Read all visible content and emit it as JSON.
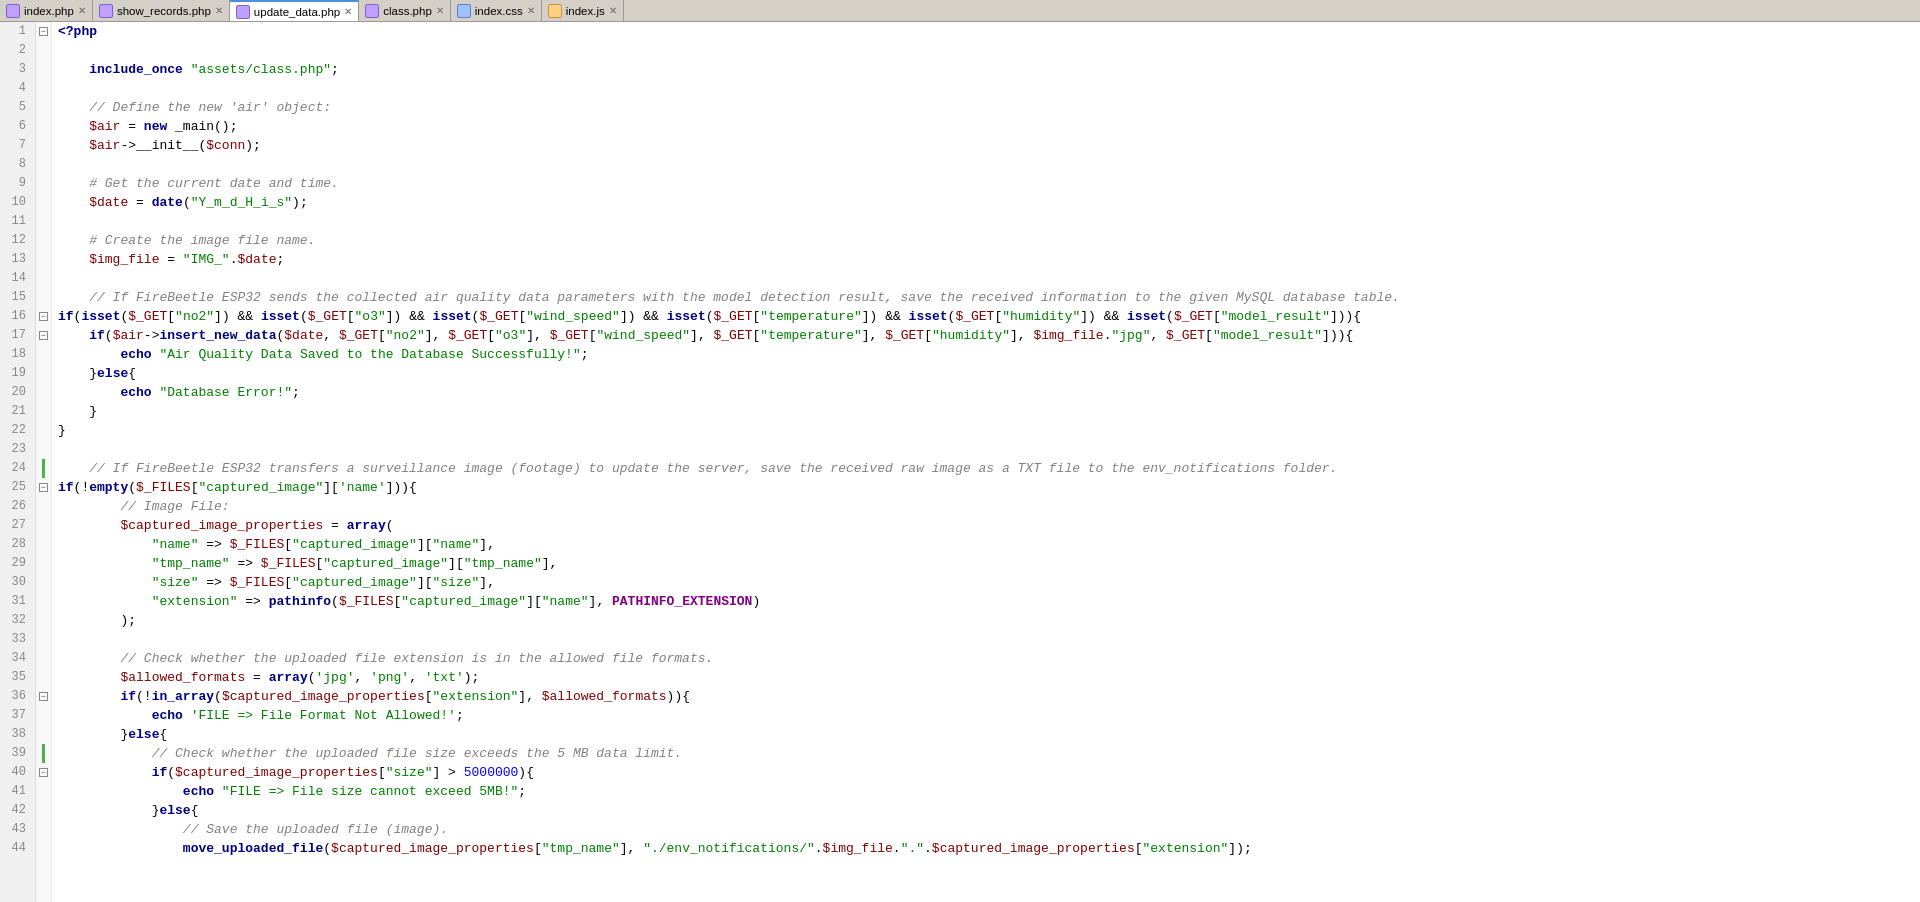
{
  "tabs": [
    {
      "label": "index.php",
      "type": "php",
      "active": false,
      "closeable": true
    },
    {
      "label": "show_records.php",
      "type": "php",
      "active": false,
      "closeable": true
    },
    {
      "label": "update_data.php",
      "type": "php",
      "active": true,
      "closeable": true
    },
    {
      "label": "class.php",
      "type": "php",
      "active": false,
      "closeable": true
    },
    {
      "label": "index.css",
      "type": "css",
      "active": false,
      "closeable": true
    },
    {
      "label": "index.js",
      "type": "js",
      "active": false,
      "closeable": true
    }
  ],
  "file": "update_data.php",
  "lines": [
    {
      "n": 1,
      "fold": "box-minus",
      "dot": false,
      "content": "php_open"
    },
    {
      "n": 2,
      "fold": "none",
      "dot": false,
      "content": "blank"
    },
    {
      "n": 3,
      "fold": "none",
      "dot": false,
      "content": "include_once"
    },
    {
      "n": 4,
      "fold": "none",
      "dot": false,
      "content": "blank"
    },
    {
      "n": 5,
      "fold": "none",
      "dot": false,
      "content": "comment_define"
    },
    {
      "n": 6,
      "fold": "none",
      "dot": false,
      "content": "air_new"
    },
    {
      "n": 7,
      "fold": "none",
      "dot": false,
      "content": "air_init"
    },
    {
      "n": 8,
      "fold": "none",
      "dot": false,
      "content": "blank"
    },
    {
      "n": 9,
      "fold": "none",
      "dot": false,
      "content": "comment_date"
    },
    {
      "n": 10,
      "fold": "none",
      "dot": false,
      "content": "date_assign"
    },
    {
      "n": 11,
      "fold": "none",
      "dot": false,
      "content": "blank"
    },
    {
      "n": 12,
      "fold": "none",
      "dot": false,
      "content": "comment_imgfile"
    },
    {
      "n": 13,
      "fold": "none",
      "dot": false,
      "content": "img_assign"
    },
    {
      "n": 14,
      "fold": "none",
      "dot": false,
      "content": "blank"
    },
    {
      "n": 15,
      "fold": "none",
      "dot": false,
      "content": "comment_firebeetle"
    },
    {
      "n": 16,
      "fold": "box-minus",
      "dot": false,
      "content": "if_isset"
    },
    {
      "n": 17,
      "fold": "box-minus",
      "dot": false,
      "content": "if_insert"
    },
    {
      "n": 18,
      "fold": "none",
      "dot": false,
      "content": "echo_saved"
    },
    {
      "n": 19,
      "fold": "none",
      "dot": false,
      "content": "brace_close_inner"
    },
    {
      "n": 20,
      "fold": "none",
      "dot": false,
      "content": "else_open"
    },
    {
      "n": 21,
      "fold": "none",
      "dot": false,
      "content": "echo_dberror"
    },
    {
      "n": 22,
      "fold": "none",
      "dot": false,
      "content": "brace_close_else"
    },
    {
      "n": 23,
      "fold": "none",
      "dot": false,
      "content": "blank"
    },
    {
      "n": 24,
      "fold": "none",
      "dot": true,
      "content": "comment_firebeetle2"
    },
    {
      "n": 25,
      "fold": "box-minus",
      "dot": false,
      "content": "if_not_empty"
    },
    {
      "n": 26,
      "fold": "none",
      "dot": false,
      "content": "comment_imagefile"
    },
    {
      "n": 27,
      "fold": "none",
      "dot": false,
      "content": "captured_assign"
    },
    {
      "n": 28,
      "fold": "none",
      "dot": false,
      "content": "arr_name"
    },
    {
      "n": 29,
      "fold": "none",
      "dot": false,
      "content": "arr_tmpname"
    },
    {
      "n": 30,
      "fold": "none",
      "dot": false,
      "content": "arr_size"
    },
    {
      "n": 31,
      "fold": "none",
      "dot": false,
      "content": "arr_extension"
    },
    {
      "n": 32,
      "fold": "none",
      "dot": false,
      "content": "arr_close"
    },
    {
      "n": 33,
      "fold": "none",
      "dot": false,
      "content": "blank"
    },
    {
      "n": 34,
      "fold": "none",
      "dot": false,
      "content": "comment_check_ext"
    },
    {
      "n": 35,
      "fold": "none",
      "dot": false,
      "content": "allowed_formats"
    },
    {
      "n": 36,
      "fold": "box-minus",
      "dot": false,
      "content": "if_not_inarray"
    },
    {
      "n": 37,
      "fold": "none",
      "dot": false,
      "content": "echo_notallowed"
    },
    {
      "n": 38,
      "fold": "none",
      "dot": false,
      "content": "brace_else2"
    },
    {
      "n": 39,
      "fold": "none",
      "dot": true,
      "content": "comment_checksize"
    },
    {
      "n": 40,
      "fold": "box-minus",
      "dot": false,
      "content": "if_size"
    },
    {
      "n": 41,
      "fold": "none",
      "dot": false,
      "content": "echo_sizeexceed"
    },
    {
      "n": 42,
      "fold": "none",
      "dot": false,
      "content": "brace_else3"
    },
    {
      "n": 43,
      "fold": "none",
      "dot": false,
      "content": "comment_save"
    },
    {
      "n": 44,
      "fold": "none",
      "dot": false,
      "content": "move_uploaded"
    }
  ]
}
